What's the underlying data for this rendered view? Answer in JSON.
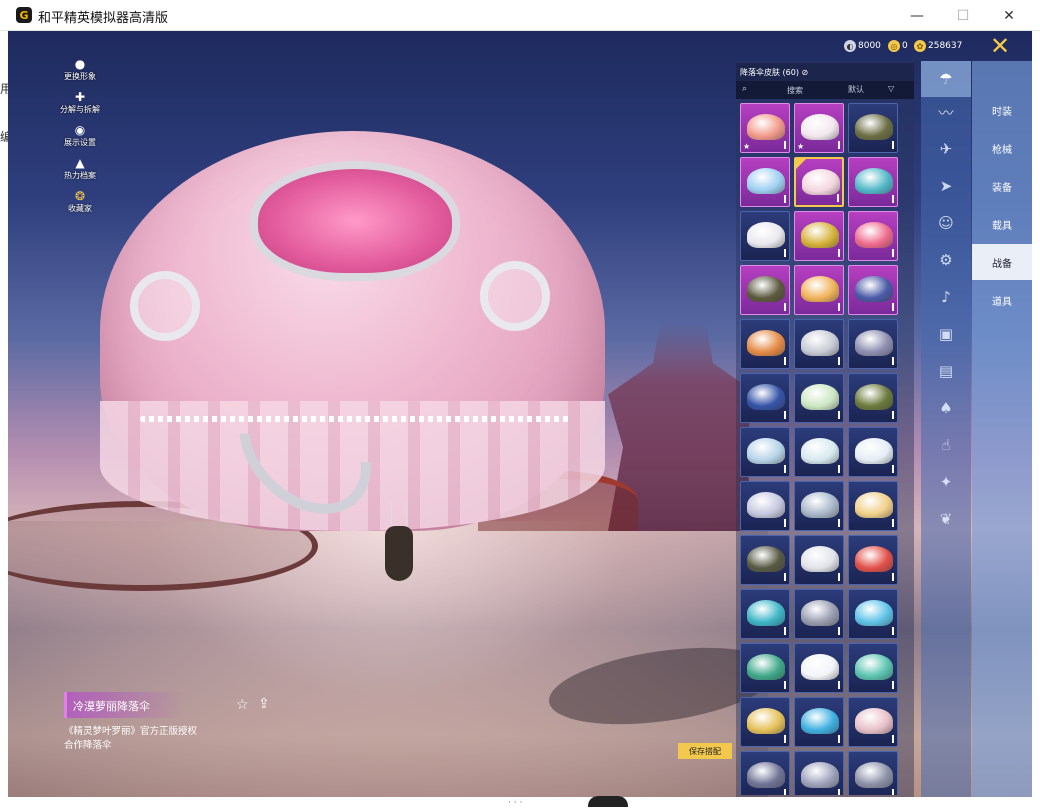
{
  "window": {
    "title": "和平精英模拟器高清版",
    "controls": {
      "minimize": "—",
      "maximize": "☐",
      "close": "✕"
    },
    "left_sliver": [
      "用",
      "编"
    ]
  },
  "left_menu": [
    {
      "label": "更换形象",
      "icon": "person-icon"
    },
    {
      "label": "分解与拆解",
      "icon": "puzzle-icon"
    },
    {
      "label": "展示设置",
      "icon": "eye-icon"
    },
    {
      "label": "热力档案",
      "icon": "flame-icon"
    },
    {
      "label": "收藏家",
      "icon": "collector-badge-icon"
    }
  ],
  "currency": [
    {
      "name": "coin-a",
      "value": "8000",
      "color": "#cfd6e6"
    },
    {
      "name": "coin-b",
      "value": "0",
      "color": "#f2c94c"
    },
    {
      "name": "coin-c",
      "value": "258637",
      "color": "#f2c94c"
    }
  ],
  "category_tabs": [
    {
      "label": "时装",
      "active": false
    },
    {
      "label": "枪械",
      "active": false
    },
    {
      "label": "装备",
      "active": false
    },
    {
      "label": "载具",
      "active": false
    },
    {
      "label": "战备",
      "active": true
    },
    {
      "label": "道具",
      "active": false
    }
  ],
  "sub_icons": [
    "parachute-icon",
    "wings-icon",
    "plane-icon",
    "glider-icon",
    "face-icon",
    "robot-icon",
    "sound-icon",
    "card-icon",
    "picture-icon",
    "spray-icon",
    "hand-icon",
    "wand-icon",
    "leaf-icon"
  ],
  "skin_panel": {
    "header": "降落伞皮肤 (60)",
    "search_placeholder": "搜索",
    "sort_label": "默认",
    "items": [
      {
        "rarity": "purple",
        "color": "#f19a8a",
        "star": true
      },
      {
        "rarity": "purple",
        "color": "#f2e7ee",
        "star": true
      },
      {
        "rarity": "blue",
        "color": "#6b6e43"
      },
      {
        "rarity": "purple",
        "color": "#9fd0f2"
      },
      {
        "rarity": "purple",
        "color": "#f4d6df",
        "selected": true
      },
      {
        "rarity": "purple",
        "color": "#53b9c9"
      },
      {
        "rarity": "blue",
        "color": "#e9e9ef"
      },
      {
        "rarity": "purple",
        "color": "#d6b23a"
      },
      {
        "rarity": "purple",
        "color": "#ef6b8d"
      },
      {
        "rarity": "purple",
        "color": "#5c5a3e"
      },
      {
        "rarity": "purple",
        "color": "#f0b35a"
      },
      {
        "rarity": "purple",
        "color": "#4a5aa8"
      },
      {
        "rarity": "blue",
        "color": "#e58b46"
      },
      {
        "rarity": "blue",
        "color": "#c9ccd6"
      },
      {
        "rarity": "blue",
        "color": "#8e8fb1"
      },
      {
        "rarity": "blue",
        "color": "#3553a8"
      },
      {
        "rarity": "blue",
        "color": "#cde7c4"
      },
      {
        "rarity": "blue",
        "color": "#6b7a3c"
      },
      {
        "rarity": "blue",
        "color": "#b7d4e8"
      },
      {
        "rarity": "blue",
        "color": "#d7e9f0"
      },
      {
        "rarity": "blue",
        "color": "#e5eef6"
      },
      {
        "rarity": "blue",
        "color": "#c5c8df"
      },
      {
        "rarity": "blue",
        "color": "#a9b8c9"
      },
      {
        "rarity": "blue",
        "color": "#f1d08a"
      },
      {
        "rarity": "blue",
        "color": "#585a44"
      },
      {
        "rarity": "blue",
        "color": "#e1e3ea"
      },
      {
        "rarity": "blue",
        "color": "#e25049"
      },
      {
        "rarity": "blue",
        "color": "#3fb6c8"
      },
      {
        "rarity": "blue",
        "color": "#9a9db0"
      },
      {
        "rarity": "blue",
        "color": "#5fc4e8"
      },
      {
        "rarity": "blue",
        "color": "#3fa88a"
      },
      {
        "rarity": "blue",
        "color": "#f2f4f8"
      },
      {
        "rarity": "blue",
        "color": "#5ac4b0"
      },
      {
        "rarity": "blue",
        "color": "#e6c15a"
      },
      {
        "rarity": "blue",
        "color": "#3fb0e0"
      },
      {
        "rarity": "blue",
        "color": "#e8c0c8"
      },
      {
        "rarity": "blue",
        "color": "#707496"
      },
      {
        "rarity": "blue",
        "color": "#9ea3bb"
      },
      {
        "rarity": "blue",
        "color": "#8d92a8"
      }
    ]
  },
  "selected_item": {
    "name": "冷漠萝丽降落伞",
    "description": "《精灵梦叶罗丽》官方正版授权合作降落伞"
  },
  "save_button": "保存搭配",
  "colors": {
    "accent": "#f2c94c",
    "purple_rarity": "#b63fc0",
    "blue_rarity": "#2c3c7a"
  }
}
